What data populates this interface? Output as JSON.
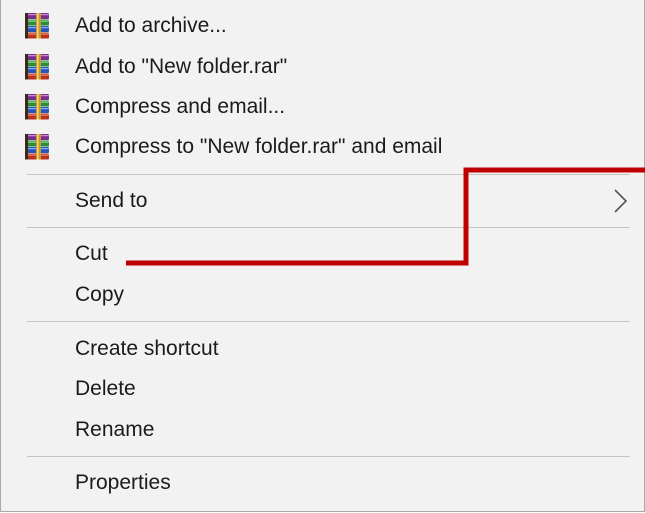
{
  "menu": {
    "items": [
      {
        "label": "Add to archive...",
        "icon": "winrar-books-icon"
      },
      {
        "label": "Add to \"New folder.rar\"",
        "icon": "winrar-books-icon"
      },
      {
        "label": "Compress and email...",
        "icon": "winrar-books-icon"
      },
      {
        "label": "Compress to \"New folder.rar\" and email",
        "icon": "winrar-books-icon"
      },
      {
        "label": "Send to",
        "icon": "chevron-right-icon"
      },
      {
        "label": "Cut"
      },
      {
        "label": "Copy"
      },
      {
        "label": "Create shortcut"
      },
      {
        "label": "Delete"
      },
      {
        "label": "Rename"
      },
      {
        "label": "Properties"
      }
    ]
  },
  "colors": {
    "menu_background": "#f2f2f2",
    "separator": "#c4c4c4",
    "callout_line": "#c00000"
  }
}
